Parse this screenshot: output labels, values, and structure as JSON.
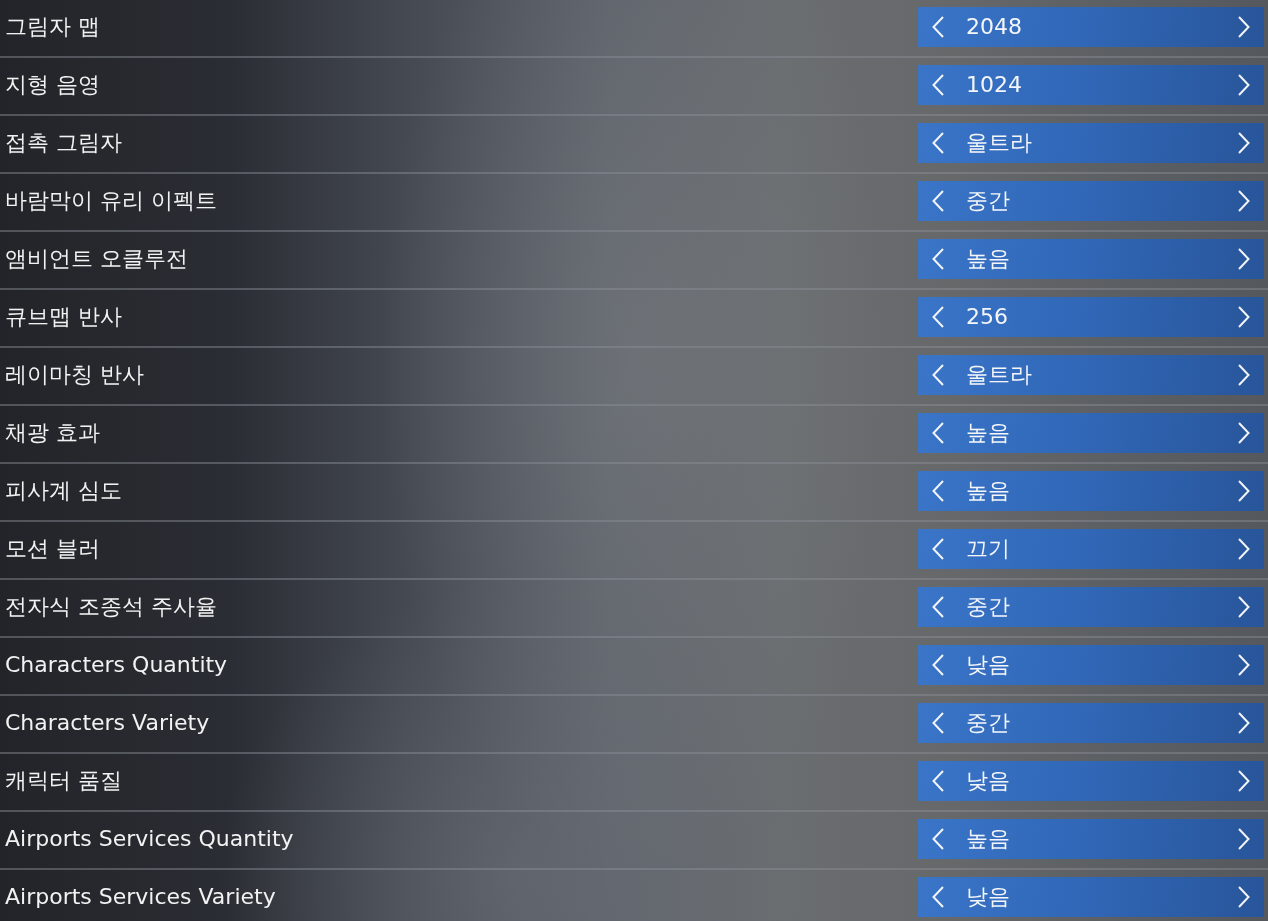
{
  "settings": [
    {
      "label": "그림자 맵",
      "value": "2048"
    },
    {
      "label": "지형 음영",
      "value": "1024"
    },
    {
      "label": "접촉 그림자",
      "value": "울트라"
    },
    {
      "label": "바람막이 유리 이펙트",
      "value": "중간"
    },
    {
      "label": "앰비언트 오클루전",
      "value": "높음"
    },
    {
      "label": "큐브맵 반사",
      "value": "256"
    },
    {
      "label": "레이마칭 반사",
      "value": "울트라"
    },
    {
      "label": "채광 효과",
      "value": "높음"
    },
    {
      "label": "피사계 심도",
      "value": "높음"
    },
    {
      "label": "모션 블러",
      "value": "끄기"
    },
    {
      "label": "전자식 조종석 주사율",
      "value": "중간"
    },
    {
      "label": "Characters Quantity",
      "value": "낮음"
    },
    {
      "label": "Characters Variety",
      "value": "중간"
    },
    {
      "label": "캐릭터 품질",
      "value": "낮음"
    },
    {
      "label": "Airports Services Quantity",
      "value": "높음"
    },
    {
      "label": "Airports Services Variety",
      "value": "낮음"
    }
  ]
}
